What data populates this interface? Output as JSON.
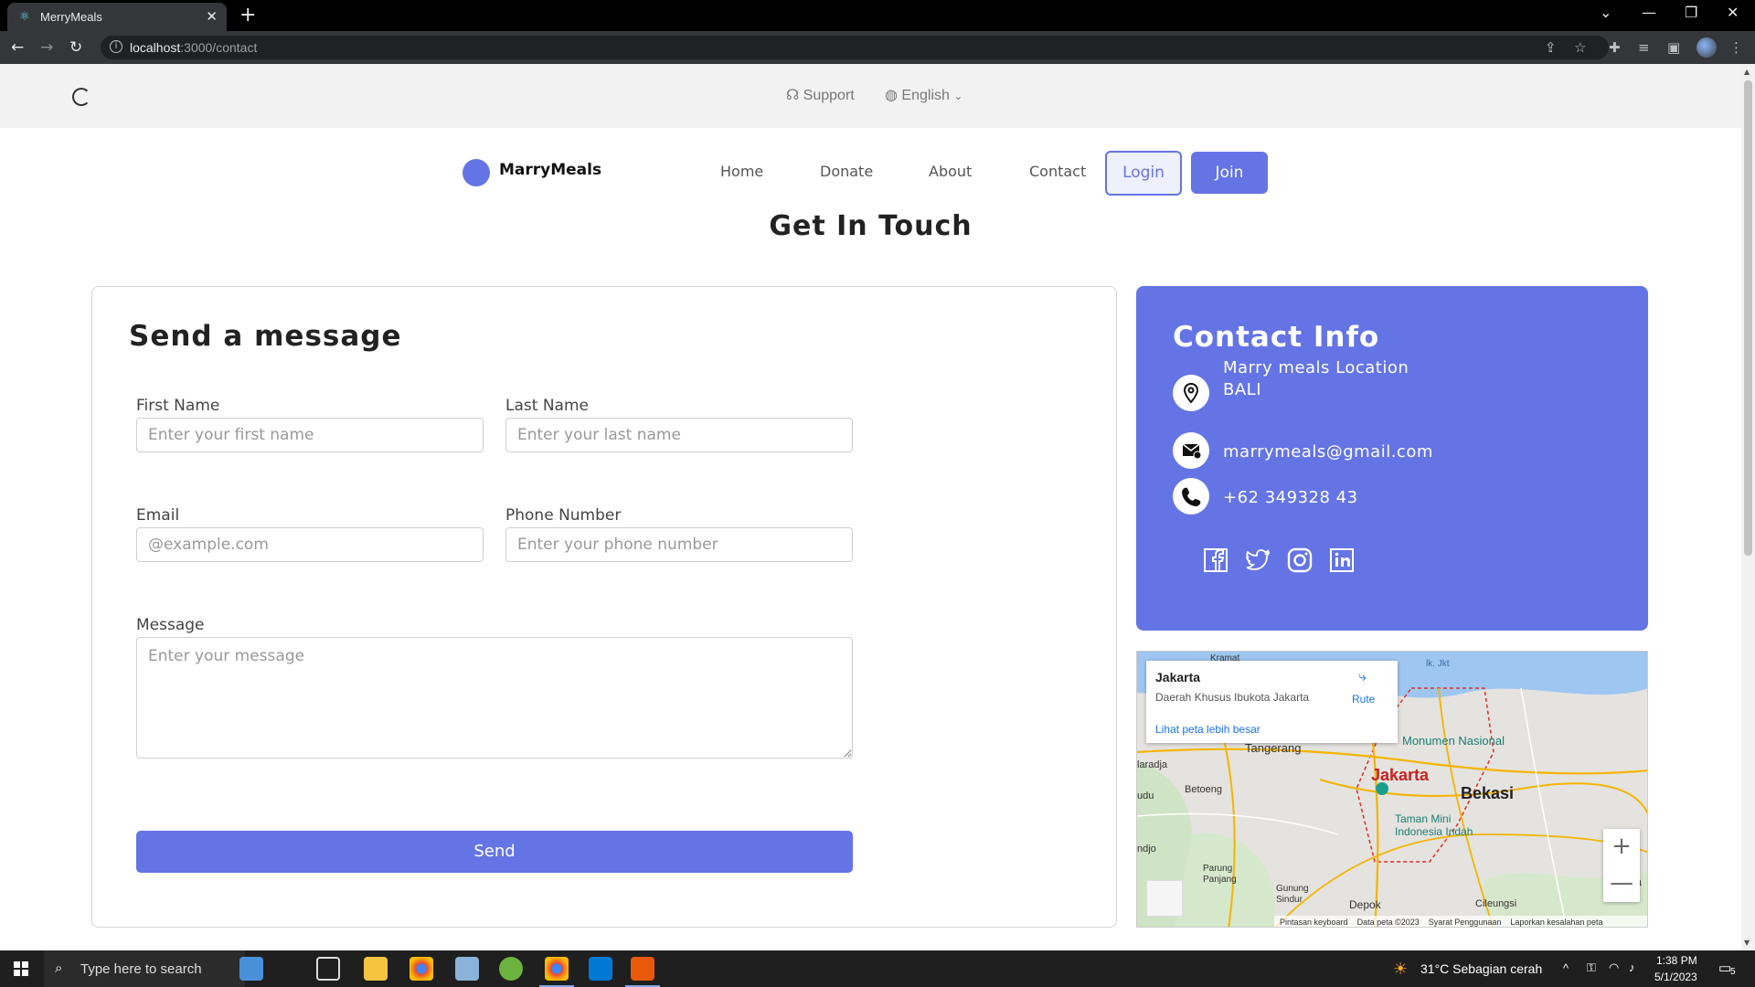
{
  "browser": {
    "tab_title": "MerryMeals",
    "url_host": "localhost",
    "url_path": ":3000/contact"
  },
  "topbar": {
    "support_label": "Support",
    "language_label": "English"
  },
  "header": {
    "brand": "MarryMeals",
    "nav": [
      "Home",
      "Donate",
      "About",
      "Contact"
    ],
    "login_label": "Login",
    "join_label": "Join"
  },
  "page_title": "Get In Touch",
  "form": {
    "title": "Send a message",
    "first_name_label": "First Name",
    "first_name_placeholder": "Enter your first name",
    "last_name_label": "Last Name",
    "last_name_placeholder": "Enter your last name",
    "email_label": "Email",
    "email_placeholder": "@example.com",
    "phone_label": "Phone Number",
    "phone_placeholder": "Enter your phone number",
    "message_label": "Message",
    "message_placeholder": "Enter your message",
    "send_label": "Send"
  },
  "contact_info": {
    "title": "Contact Info",
    "location_line1": "Marry meals Location",
    "location_line2": "BALI",
    "email": "marrymeals@gmail.com",
    "phone": "+62 349328 43",
    "socials": [
      "facebook-icon",
      "twitter-icon",
      "instagram-icon",
      "linkedin-icon"
    ],
    "accent_color": "#6474e5"
  },
  "map": {
    "place_title": "Jakarta",
    "place_subtitle": "Daerah Khusus Ibukota Jakarta",
    "directions_label": "Rute",
    "larger_map_link": "Lihat peta lebih besar",
    "labels": {
      "kramat": "Kramat",
      "jkt": "lk. Jkt",
      "monumen": "Monumen Nasional",
      "tangerang": "Tangerang",
      "laradja": "laradja",
      "jakarta": "Jakarta",
      "betoeng": "Betoeng",
      "bekasi": "Bekasi",
      "udu": "udu",
      "taman": "Taman Mini",
      "indonesia": "Indonesia Indah",
      "ndjo": "ndjo",
      "parung": "Parung",
      "panjang": "Panjang",
      "gunung": "Gunung",
      "sindur": "Sindur",
      "depok": "Depok",
      "cileungsi": "Cileungsi",
      "ka": "Ka"
    },
    "zoom_in": "+",
    "zoom_out": "—",
    "footer_keyboard": "Pintasan keyboard",
    "footer_data": "Data peta ©2023",
    "footer_terms": "Syarat Penggunaan",
    "footer_report": "Laporkan kesalahan peta"
  },
  "taskbar": {
    "search_placeholder": "Type here to search",
    "weather": "31°C  Sebagian cerah",
    "time": "1:38 PM",
    "date": "5/1/2023",
    "notifications": "5"
  }
}
